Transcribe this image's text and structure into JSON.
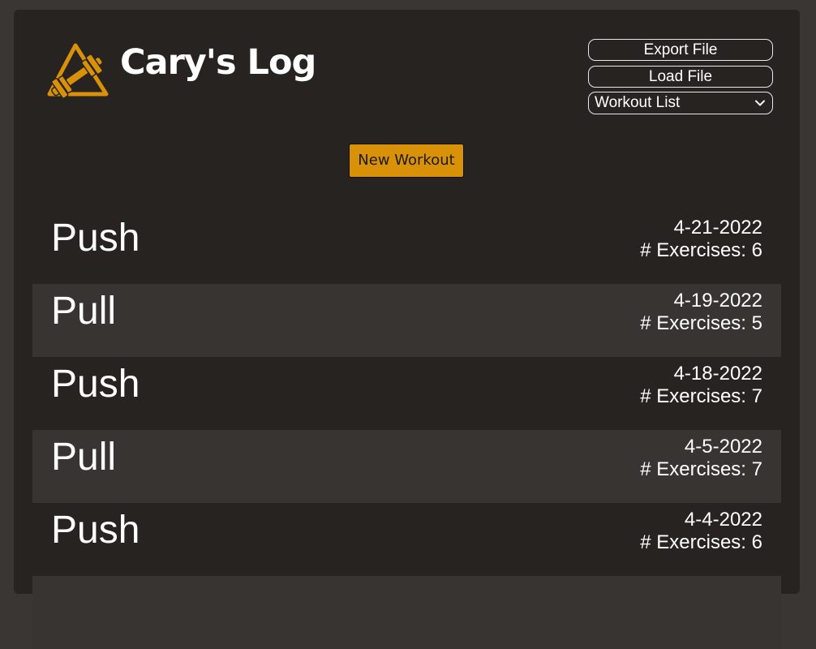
{
  "header": {
    "title": "Cary's Log",
    "logo_icon": "dumbbell-triangle-icon",
    "accent_color": "#d99107"
  },
  "controls": {
    "export_label": "Export File",
    "load_label": "Load File",
    "workout_select_value": "Workout List",
    "new_workout_label": "New Workout"
  },
  "workouts": [
    {
      "name": "Push",
      "date": "4-21-2022",
      "exercise_prefix": "# Exercises: ",
      "exercise_count": "6"
    },
    {
      "name": "Pull",
      "date": "4-19-2022",
      "exercise_prefix": "# Exercises: ",
      "exercise_count": "5"
    },
    {
      "name": "Push",
      "date": "4-18-2022",
      "exercise_prefix": "# Exercises: ",
      "exercise_count": "7"
    },
    {
      "name": "Pull",
      "date": "4-5-2022",
      "exercise_prefix": "# Exercises: ",
      "exercise_count": "7"
    },
    {
      "name": "Push",
      "date": "4-4-2022",
      "exercise_prefix": "# Exercises: ",
      "exercise_count": "6"
    }
  ]
}
